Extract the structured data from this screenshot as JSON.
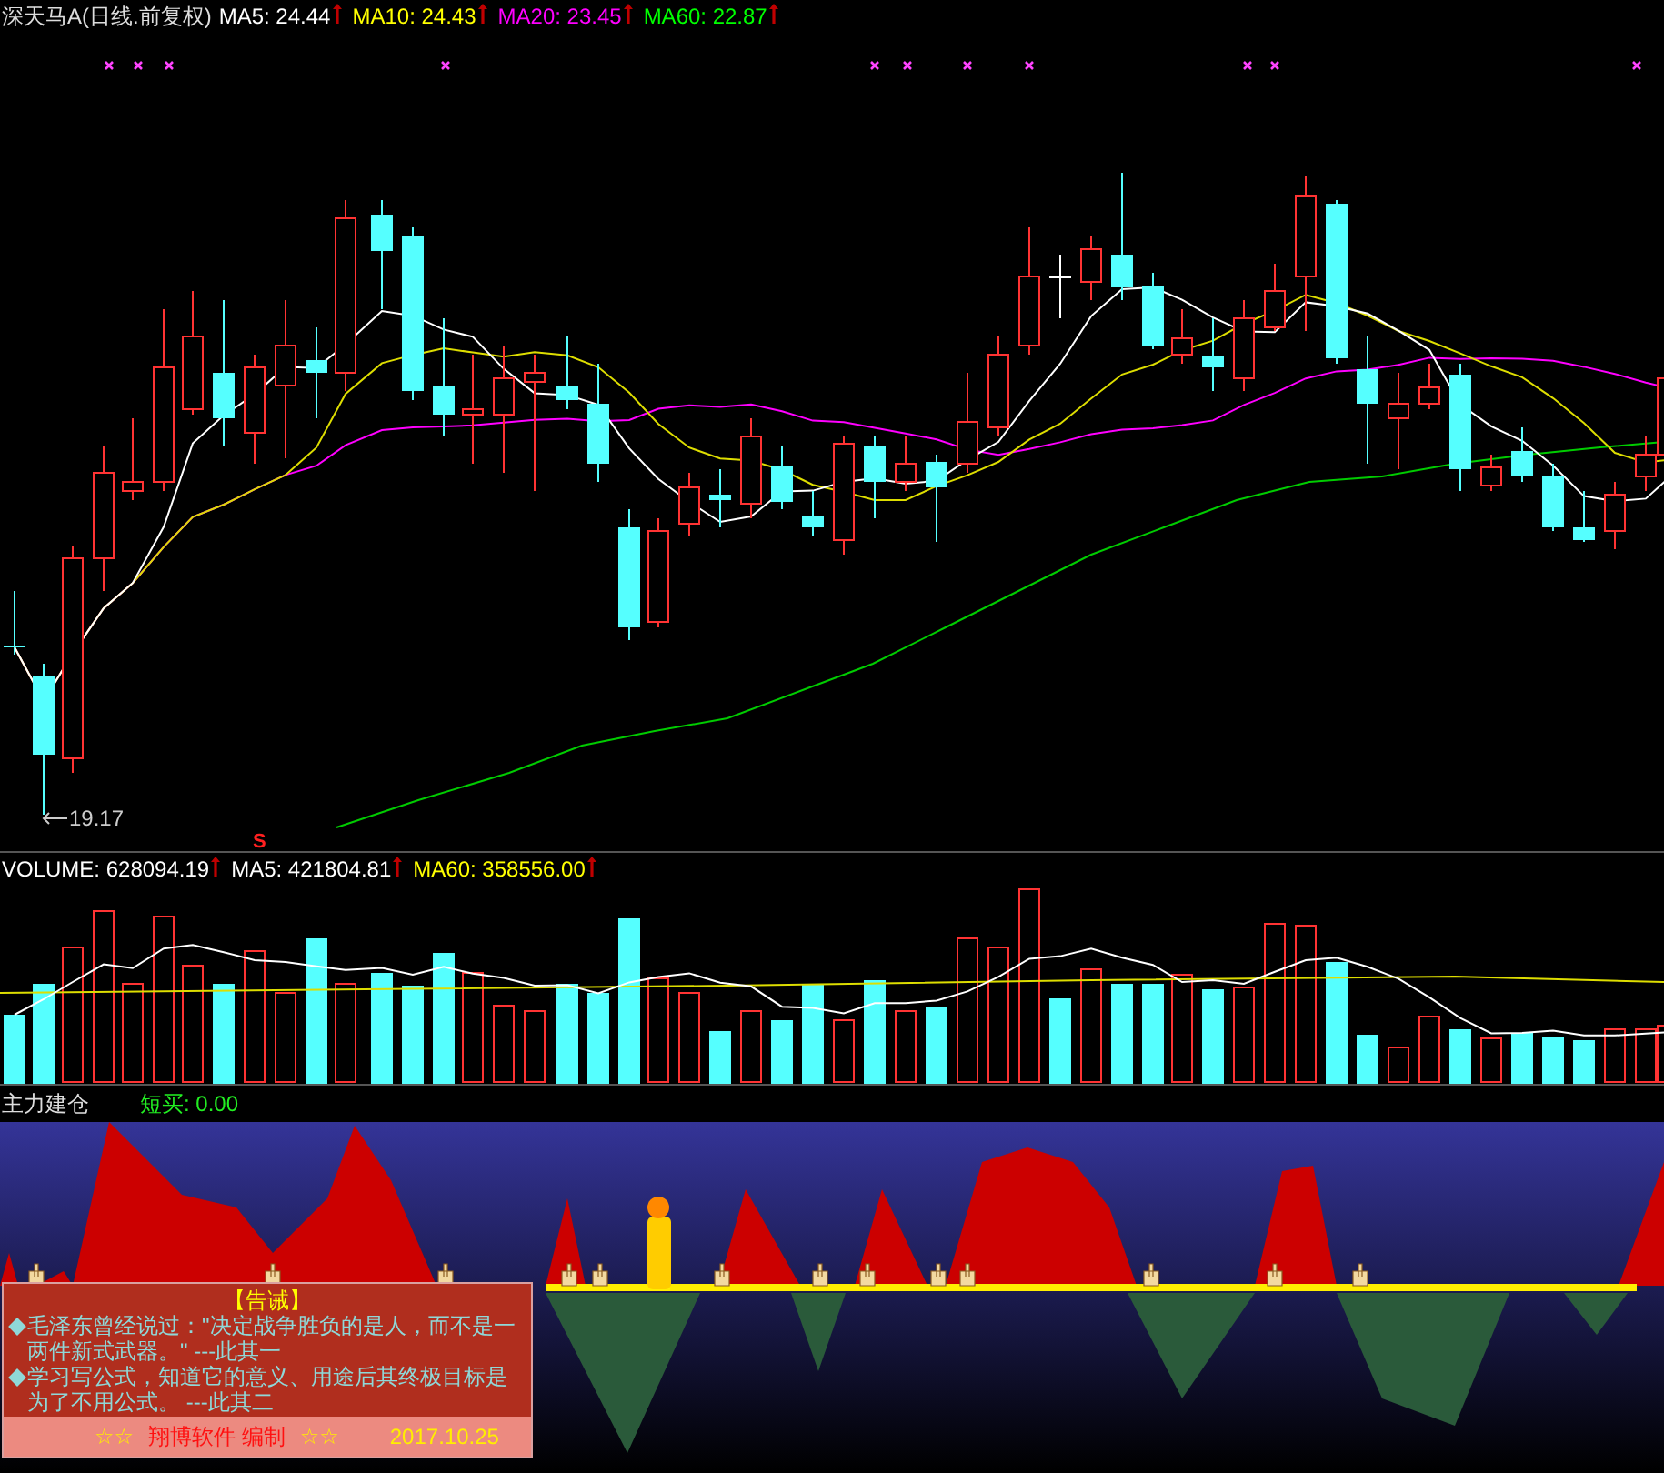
{
  "price_panel": {
    "title": "深天马A(日线.前复权)",
    "indicators": [
      {
        "label": "MA5: 24.44",
        "color": "#ffffff"
      },
      {
        "label": "MA10: 24.43",
        "color": "#ffff00"
      },
      {
        "label": "MA20: 23.45",
        "color": "#ff00ff"
      },
      {
        "label": "MA60: 22.87",
        "color": "#00ff00"
      }
    ],
    "low_label": "19.17",
    "signal_mark": "S"
  },
  "volume_panel": {
    "indicators": [
      {
        "label": "VOLUME: 628094.19",
        "color": "#ffffff"
      },
      {
        "label": "MA5: 421804.81",
        "color": "#ffffff"
      },
      {
        "label": "MA60: 358556.00",
        "color": "#ffff00"
      }
    ]
  },
  "indicator_panel": {
    "title": "主力建仓",
    "readout": "短买: 0.00"
  },
  "notice": {
    "title": "【告诫】",
    "items": [
      "毛泽东曾经说过：\"决定战争胜负的是人，而不是一两件新式武器。\" ---此其一",
      "学习写公式，知道它的意义、用途后其终极目标是为了不用公式。 ---此其二"
    ],
    "stars_left": "☆☆",
    "brand": "翔博软件 编制",
    "stars_right": "☆☆",
    "date": "2017.10.25"
  }
}
